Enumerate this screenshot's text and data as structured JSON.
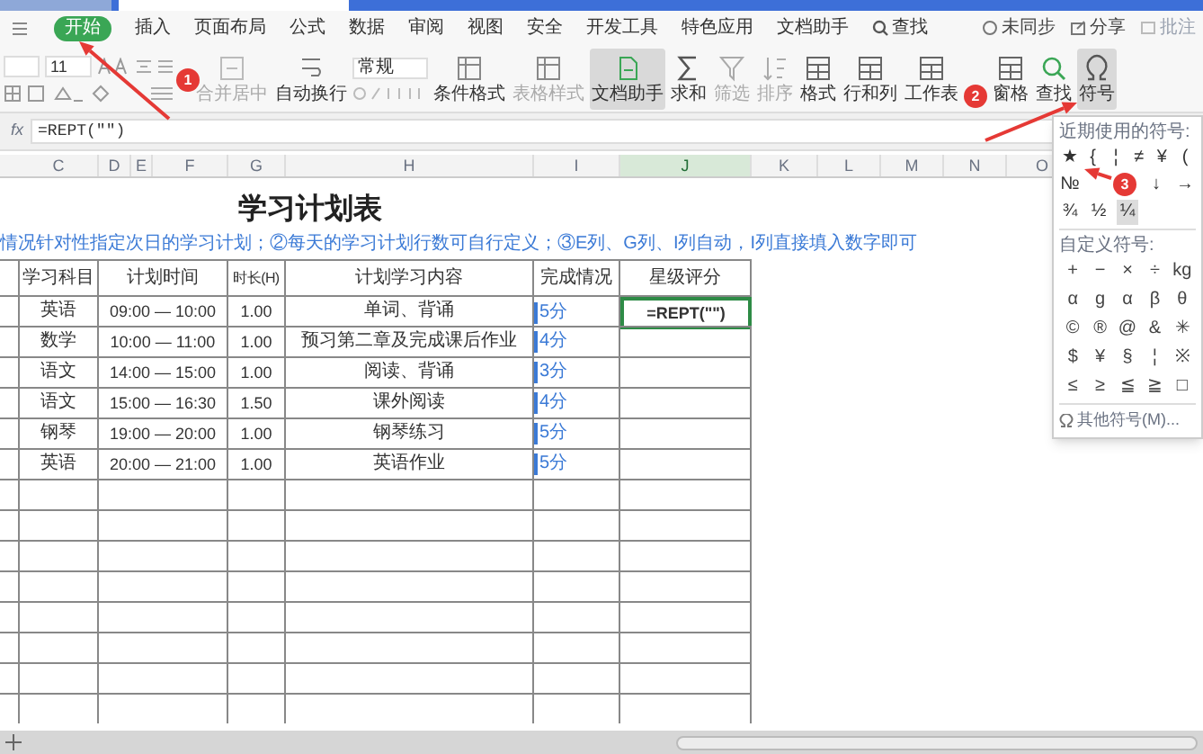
{
  "menu": {
    "tabs": [
      {
        "label": "开始",
        "selected": true,
        "kind": "tab"
      },
      {
        "label": "插入",
        "selected": false,
        "kind": "tab"
      },
      {
        "label": "页面布局",
        "selected": false,
        "kind": "tab"
      },
      {
        "label": "公式",
        "selected": false,
        "kind": "tab"
      },
      {
        "label": "数据",
        "selected": false,
        "kind": "tab"
      },
      {
        "label": "审阅",
        "selected": false,
        "kind": "tab"
      },
      {
        "label": "视图",
        "selected": false,
        "kind": "tab"
      },
      {
        "label": "安全",
        "selected": false,
        "kind": "tab"
      },
      {
        "label": "开发工具",
        "selected": false,
        "kind": "tab"
      },
      {
        "label": "特色应用",
        "selected": false,
        "kind": "tab"
      },
      {
        "label": "文档助手",
        "selected": false,
        "kind": "tab"
      },
      {
        "label": "查找",
        "selected": false,
        "kind": "search"
      }
    ],
    "account": [
      {
        "label": "未同步",
        "kind": "sync"
      },
      {
        "label": "分享",
        "kind": "share"
      },
      {
        "label": "批注",
        "kind": "comment"
      }
    ]
  },
  "toolbar": {
    "font_size": "11",
    "number_format": "常规",
    "badge": "1",
    "buttons": [
      {
        "label": "合并居中",
        "kind": "merge",
        "active": false,
        "disabled": true
      },
      {
        "label": "自动换行",
        "kind": "wrap",
        "active": false,
        "disabled": false
      },
      {
        "label": "条件格式",
        "kind": "sheet",
        "active": false,
        "disabled": false
      },
      {
        "label": "表格样式",
        "kind": "sheet",
        "active": false,
        "disabled": true
      },
      {
        "label": "文档助手",
        "kind": "doc",
        "active": true,
        "disabled": false
      },
      {
        "label": "求和",
        "kind": "sum",
        "active": false,
        "disabled": false
      },
      {
        "label": "筛选",
        "kind": "filter",
        "active": false,
        "disabled": true
      },
      {
        "label": "排序",
        "kind": "sort",
        "active": false,
        "disabled": true
      },
      {
        "label": "格式",
        "kind": "table",
        "active": false,
        "disabled": false
      },
      {
        "label": "行和列",
        "kind": "table",
        "active": false,
        "disabled": false
      },
      {
        "label": "工作表",
        "kind": "table",
        "active": false,
        "disabled": false
      },
      {
        "label": "窗格",
        "kind": "table",
        "active": false,
        "disabled": false,
        "badge": "2"
      },
      {
        "label": "查找",
        "kind": "find",
        "active": false,
        "disabled": false
      },
      {
        "label": "符号",
        "kind": "omega",
        "active": true,
        "disabled": false
      }
    ]
  },
  "formula_bar": {
    "label": "fx",
    "formula": "=REPT(\"\")"
  },
  "columns": [
    {
      "label": "C",
      "selected": false
    },
    {
      "label": "D",
      "selected": false
    },
    {
      "label": "E",
      "selected": false
    },
    {
      "label": "F",
      "selected": false
    },
    {
      "label": "G",
      "selected": false
    },
    {
      "label": "H",
      "selected": false
    },
    {
      "label": "I",
      "selected": false
    },
    {
      "label": "J",
      "selected": true
    },
    {
      "label": "K",
      "selected": false
    },
    {
      "label": "L",
      "selected": false
    },
    {
      "label": "M",
      "selected": false
    },
    {
      "label": "N",
      "selected": false
    },
    {
      "label": "O",
      "selected": false
    }
  ],
  "sheet": {
    "title": "学习计划表",
    "note": "情况针对性指定次日的学习计划；②每天的学习计划行数可自行定义；③E列、G列、I列自动，I列直接填入数字即可",
    "table": {
      "columns": [
        "学习科目",
        "计划时间",
        "时长(H)",
        "计划学习内容",
        "完成情况",
        "星级评分"
      ],
      "rows": [
        {
          "subject": "英语",
          "time": "09:00 — 10:00",
          "hours": "1.00",
          "content": "单词、背诵",
          "completion": "5分",
          "rating": "=REPT(\"\")",
          "selected": true
        },
        {
          "subject": "数学",
          "time": "10:00 — 11:00",
          "hours": "1.00",
          "content": "预习第二章及完成课后作业",
          "completion": "4分",
          "selected": false
        },
        {
          "subject": "语文",
          "time": "14:00 — 15:00",
          "hours": "1.00",
          "content": "阅读、背诵",
          "completion": "3分",
          "selected": false
        },
        {
          "subject": "语文",
          "time": "15:00 — 16:30",
          "hours": "1.50",
          "content": "课外阅读",
          "completion": "4分",
          "selected": false
        },
        {
          "subject": "钢琴",
          "time": "19:00 — 20:00",
          "hours": "1.00",
          "content": "钢琴练习",
          "completion": "5分",
          "selected": false
        },
        {
          "subject": "英语",
          "time": "20:00 — 21:00",
          "hours": "1.00",
          "content": "英语作业",
          "completion": "5分",
          "selected": false
        }
      ]
    }
  },
  "symbol_panel": {
    "recent_label": "近期使用的符号:",
    "badge": "3",
    "recent": [
      [
        {
          "symbol": "★",
          "selected": false
        },
        {
          "symbol": "{",
          "selected": false
        },
        {
          "symbol": "¦",
          "selected": false
        },
        {
          "symbol": "≠",
          "selected": false
        },
        {
          "symbol": "¥",
          "selected": false
        },
        {
          "symbol": "(",
          "selected": false
        }
      ],
      [
        {
          "symbol": "№",
          "selected": false
        },
        {
          "symbol": "↓",
          "selected": false
        },
        {
          "symbol": "→",
          "selected": false
        }
      ],
      [
        {
          "symbol": "¾",
          "selected": false
        },
        {
          "symbol": "½",
          "selected": false
        },
        {
          "symbol": "¼",
          "selected": true
        }
      ]
    ],
    "custom_label": "自定义符号:",
    "custom": [
      [
        "+",
        "−",
        "×",
        "÷",
        "kg"
      ],
      [
        "α",
        "g",
        "α",
        "β",
        "θ"
      ],
      [
        "©",
        "®",
        "@",
        "&",
        "✳"
      ],
      [
        "$",
        "¥",
        "§",
        "¦",
        "※"
      ],
      [
        "≤",
        "≥",
        "≦",
        "≧",
        "□"
      ]
    ],
    "more": "其他符号(M)..."
  }
}
